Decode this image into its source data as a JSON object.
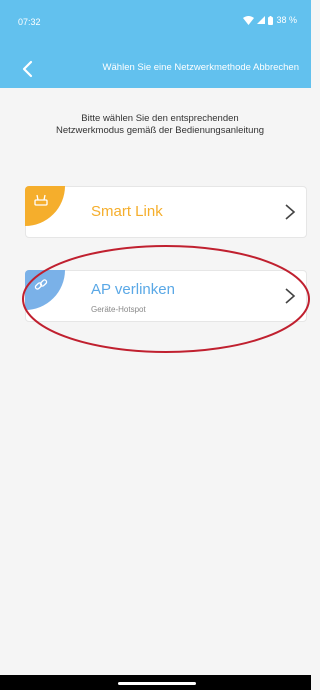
{
  "status": {
    "time": "07:32",
    "battery": "38 %"
  },
  "header": {
    "title": "Wählen Sie eine Netzwerkmethode Abbrechen"
  },
  "instruction": {
    "line1": "Bitte wählen Sie den entsprechenden",
    "line2": "Netzwerkmodus gemäß der Bedienungsanleitung"
  },
  "options": [
    {
      "title": "Smart Link",
      "subtitle": "",
      "icon": "router-icon",
      "color": "#f5ae2c"
    },
    {
      "title": "AP verlinken",
      "subtitle": "Geräte-Hotspot",
      "icon": "link-icon",
      "color": "#7ab1e8"
    }
  ],
  "colors": {
    "header": "#62c1ee",
    "smart_link_text": "#f5ae2c",
    "ap_text": "#5aa8e6",
    "annotation": "#c0202f"
  }
}
